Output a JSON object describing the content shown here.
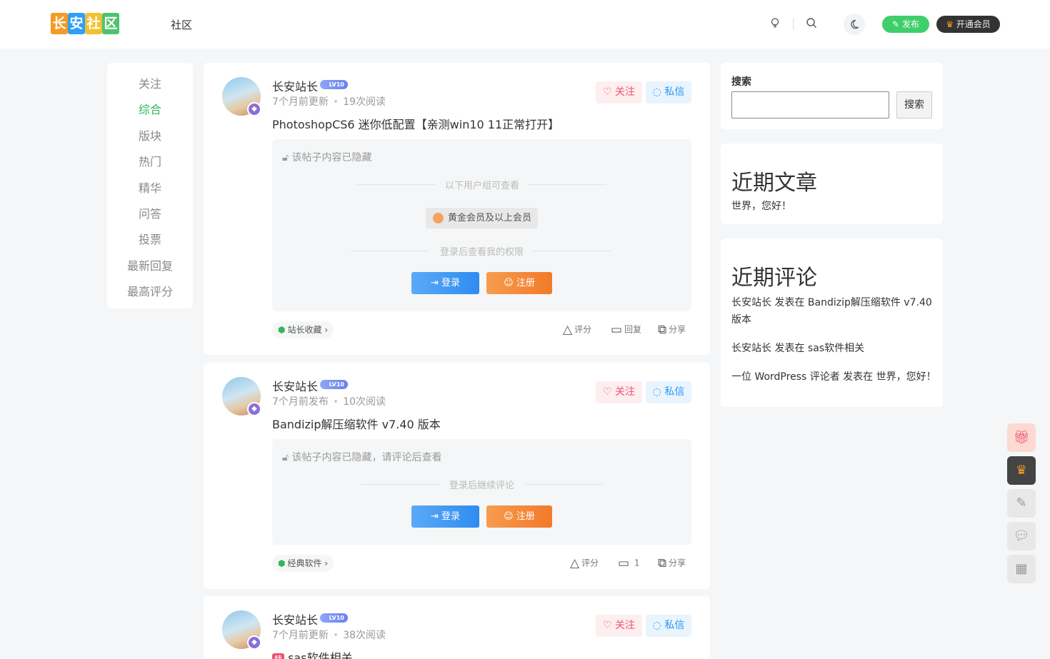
{
  "header": {
    "logo_chars": [
      "长",
      "安",
      "社",
      "区"
    ],
    "logo_colors": [
      "#f59a23",
      "#2f9ff7",
      "#f2c12e",
      "#4fc36b"
    ],
    "nav_community": "社区",
    "publish_label": "发布",
    "vip_label": "开通会员"
  },
  "leftnav": {
    "items": [
      "关注",
      "综合",
      "版块",
      "热门",
      "精华",
      "问答",
      "投票",
      "最新回复",
      "最高评分"
    ],
    "active": "综合",
    "active_color": "#30b65b"
  },
  "posts": [
    {
      "author": "长安站长",
      "level": "LV10",
      "time": "7个月前更新",
      "views": "19次阅读",
      "follow": "关注",
      "message": "私信",
      "title": "PhotoshopCS6 迷你低配置【亲测win10 11正常打开】",
      "hidden_note": "该帖子内容已隐藏",
      "divider1": "以下用户组可查看",
      "group": "黄金会员及以上会员",
      "divider2": "登录后查看我的权限",
      "login": "登录",
      "register": "注册",
      "tag": "站长收藏",
      "rate": "评分",
      "reply": "回复",
      "share": "分享"
    },
    {
      "author": "长安站长",
      "level": "LV10",
      "time": "7个月前发布",
      "views": "10次阅读",
      "follow": "关注",
      "message": "私信",
      "title": "Bandizip解压缩软件 v7.40 版本",
      "hidden_note": "该帖子内容已隐藏，请评论后查看",
      "divider1": "登录后继续评论",
      "login": "登录",
      "register": "注册",
      "tag": "经典软件",
      "rate": "评分",
      "reply": "1",
      "share": "分享"
    },
    {
      "author": "长安站长",
      "level": "LV10",
      "time": "7个月前更新",
      "views": "38次阅读",
      "follow": "关注",
      "message": "私信",
      "badge": "精",
      "title": "sas软件相关"
    }
  ],
  "sidebar": {
    "search_title": "搜索",
    "search_button": "搜索",
    "recent_posts_title": "近期文章",
    "recent_posts": [
      "世界，您好！"
    ],
    "recent_comments_title": "近期评论",
    "recent_comments": [
      "长安站长 发表在 Bandizip解压缩软件 v7.40 版本",
      "长安站长 发表在 sas软件相关",
      "一位 WordPress 评论者 发表在 世界，您好！"
    ]
  },
  "colors": {
    "accent_green": "#3fcf6a",
    "follow_red": "#f0506e",
    "message_blue": "#2997f7",
    "login_blue": "#2f8cf0",
    "register_orange": "#f27a2a"
  }
}
